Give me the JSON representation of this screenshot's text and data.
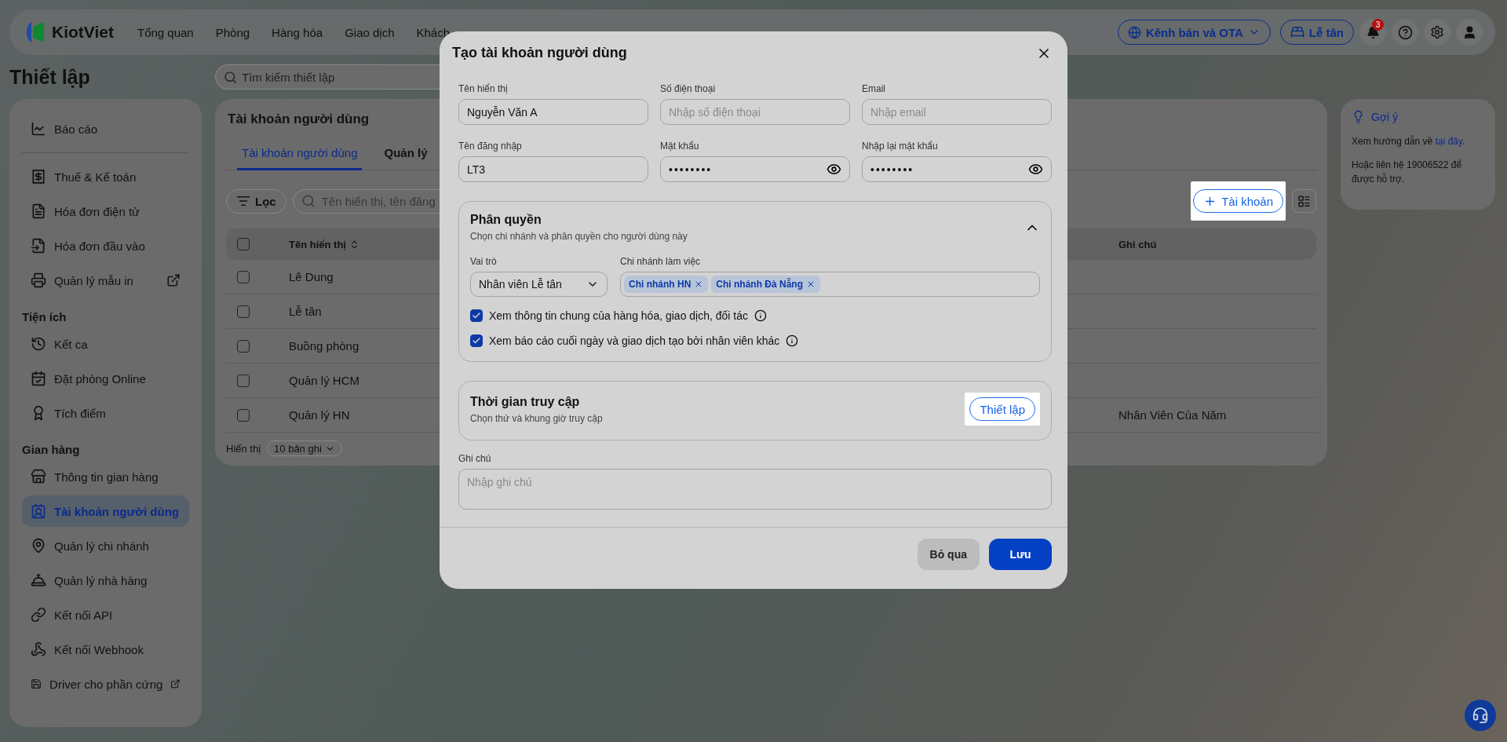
{
  "header": {
    "logo": "KiotViet",
    "nav": [
      "Tổng quan",
      "Phòng",
      "Hàng hóa",
      "Giao dịch",
      "Khách"
    ],
    "channel_button": "Kênh bán và OTA",
    "reception_button": "Lễ tân",
    "notification_count": "3"
  },
  "page_title": "Thiết lập",
  "settings_search": {
    "placeholder": "Tìm kiếm thiết lập"
  },
  "sidebar": {
    "sections": [
      {
        "items": [
          {
            "label": "Báo cáo",
            "selected": false,
            "external": false
          }
        ]
      },
      {
        "items": [
          {
            "label": "Thuế & Kế toán",
            "selected": false,
            "external": false
          },
          {
            "label": "Hóa đơn điện tử",
            "selected": false,
            "external": false
          },
          {
            "label": "Hóa đơn đầu vào",
            "selected": false,
            "external": false
          },
          {
            "label": "Quản lý mẫu in",
            "selected": false,
            "external": true
          }
        ]
      },
      {
        "heading": "Tiện ích",
        "items": [
          {
            "label": "Kết ca",
            "selected": false,
            "external": false
          },
          {
            "label": "Đặt phòng Online",
            "selected": false,
            "external": false
          },
          {
            "label": "Tích điểm",
            "selected": false,
            "external": false
          }
        ]
      },
      {
        "heading": "Gian hàng",
        "items": [
          {
            "label": "Thông tin gian hàng",
            "selected": false,
            "external": false
          },
          {
            "label": "Tài khoản người dùng",
            "selected": true,
            "external": false
          },
          {
            "label": "Quản lý chi nhánh",
            "selected": false,
            "external": false
          },
          {
            "label": "Quản lý nhà hàng",
            "selected": false,
            "external": false
          },
          {
            "label": "Kết nối API",
            "selected": false,
            "external": false
          },
          {
            "label": "Kết nối Webhook",
            "selected": false,
            "external": false
          },
          {
            "label": "Driver cho phần cứng",
            "selected": false,
            "external": true
          }
        ]
      }
    ]
  },
  "main": {
    "title": "Tài khoản người dùng",
    "tabs": [
      {
        "label": "Tài khoản người dùng",
        "selected": true
      },
      {
        "label": "Quản lý",
        "selected": false
      }
    ],
    "filter_button": "Lọc",
    "search": {
      "placeholder": "Tên hiển thị, tên đăng"
    },
    "add_button": {
      "label": "Tài khoản",
      "highlighted": true
    },
    "table": {
      "all_checked": false,
      "columns": [
        "Tên hiển thị",
        "Ghi chú"
      ],
      "rows": [
        {
          "name": "Lê Dung",
          "note": null,
          "checked": false
        },
        {
          "name": "Lễ tân",
          "note": null,
          "checked": false
        },
        {
          "name": "Buồng phòng",
          "note": null,
          "checked": false
        },
        {
          "name": "Quản lý HCM",
          "note": null,
          "checked": false
        },
        {
          "name": "Quản lý HN",
          "note": "Nhân Viên Của Năm",
          "checked": false
        }
      ]
    },
    "page_size_label": "Hiển thị",
    "page_size": "10 bản ghi"
  },
  "hint": {
    "title": "Gợi ý",
    "line1": "Xem hướng dẫn về ",
    "link": "tại đây",
    "line1_end": ".",
    "line2": "Hoặc liên hệ 19006522 để được hỗ trợ."
  },
  "modal": {
    "title": "Tạo tài khoản người dùng",
    "fields": [
      {
        "label": "Tên hiển thị",
        "value": "Nguyễn Văn A",
        "kind": "text"
      },
      {
        "label": "Số điện thoại",
        "placeholder": "Nhập số điện thoại",
        "kind": "text"
      },
      {
        "label": "Email",
        "placeholder": "Nhập email",
        "kind": "text"
      },
      {
        "label": "Tên đăng nhập",
        "value": "LT3",
        "kind": "text"
      },
      {
        "label": "Mật khẩu",
        "value": "••••••••",
        "kind": "password"
      },
      {
        "label": "Nhập lại mật khẩu",
        "value": "••••••••",
        "kind": "password"
      }
    ],
    "permissions": {
      "title": "Phân quyền",
      "subtitle": "Chọn chi nhánh và phân quyền cho người dùng này",
      "expanded": true,
      "role_label": "Vai trò",
      "role": "Nhân viên Lễ tân",
      "branch_label": "Chi nhánh làm việc",
      "branches": [
        "Chi nhánh HN",
        "Chi nhánh Đà Nẵng"
      ],
      "options": [
        {
          "label": "Xem thông tin chung của hàng hóa, giao dịch, đối tác",
          "checked": true
        },
        {
          "label": "Xem báo cáo cuối ngày và giao dịch tạo bởi nhân viên khác",
          "checked": true
        }
      ]
    },
    "access": {
      "title": "Thời gian truy cập",
      "subtitle": "Chọn thứ và khung giờ truy cập",
      "button": {
        "label": "Thiết lập",
        "highlighted": true
      }
    },
    "note": {
      "label": "Ghi chú",
      "placeholder": "Nhập ghi chú"
    },
    "cancel": "Bỏ qua",
    "save": "Lưu"
  }
}
